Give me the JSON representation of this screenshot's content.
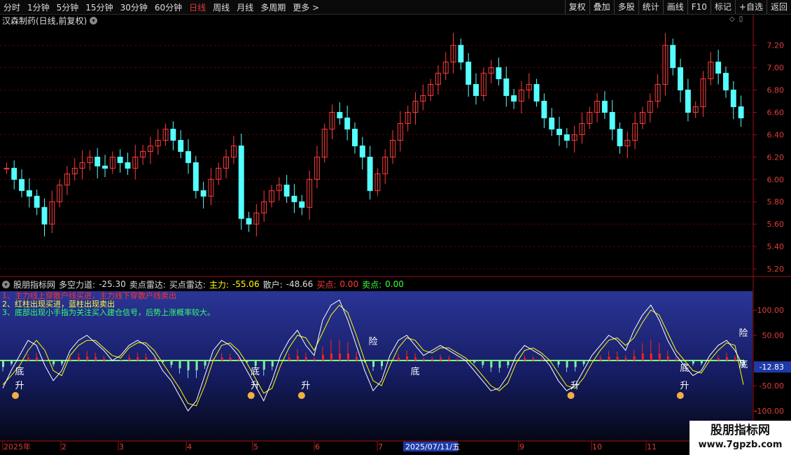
{
  "toolbar": {
    "periods": [
      "分时",
      "1分钟",
      "5分钟",
      "15分钟",
      "30分钟",
      "60分钟",
      "日线",
      "周线",
      "月线",
      "多周期",
      "更多 >"
    ],
    "active_period": "日线",
    "buttons": [
      "复权",
      "叠加",
      "多股",
      "统计",
      "画线",
      "F10",
      "标记",
      "+自选",
      "返回"
    ]
  },
  "stock": {
    "title": "汉森制药(日线,前复权)"
  },
  "price_axis": {
    "ticks": [
      "7.20",
      "7.00",
      "6.80",
      "6.60",
      "6.40",
      "6.20",
      "6.00",
      "5.80",
      "5.60",
      "5.40",
      "5.20"
    ]
  },
  "indicator": {
    "name": "股朋指标网",
    "dkld_label": "多空力道:",
    "dkld_value": "-25.30",
    "mdld_label": "卖点雷达:",
    "mdld2_label": "买点雷达:",
    "zl_label": "主力:",
    "zl_value": "-55.06",
    "sh_label": "散户:",
    "sh_value": "-48.66",
    "sell_label": "买点:",
    "sell_value": "0.00",
    "buy_label": "卖点:",
    "buy_value": "0.00",
    "axis_ticks": [
      "100.00",
      "50.00",
      "-50.00",
      "-100.00"
    ],
    "current_value": "-12.83",
    "legend": [
      "1、主力线上穿散户线买进，主力线下穿散户线卖出",
      "2、红柱出现买进，蓝柱出现卖出",
      "3、底部出现小手指为关注买入建仓信号，后势上涨概率较大。"
    ],
    "marks": {
      "di": "底",
      "sheng": "升",
      "xian": "险"
    }
  },
  "date_axis": {
    "labels": [
      "2025年",
      "2",
      "3",
      "4",
      "5",
      "6",
      "7",
      "2025/07/11/五",
      "9",
      "10",
      "11"
    ]
  },
  "watermark": {
    "title": "股朋指标网",
    "url": "www.7gpzb.com"
  },
  "colors": {
    "up": "#ff3c3c",
    "down": "#54ffff",
    "main_line": "#ffffff",
    "retail_line": "#ffff00",
    "green_band": "#7fff7f",
    "red_band": "#ff2020",
    "indicator_bg": "#1e2a8a"
  },
  "chart_data": {
    "type": "candlestick",
    "price_ylim": [
      5.15,
      7.38
    ],
    "closes": [
      6.1,
      6.0,
      5.9,
      5.85,
      5.75,
      5.6,
      5.8,
      5.95,
      6.05,
      6.1,
      6.15,
      6.2,
      6.12,
      6.1,
      6.2,
      6.15,
      6.1,
      6.2,
      6.25,
      6.3,
      6.35,
      6.45,
      6.35,
      6.25,
      6.15,
      5.9,
      5.85,
      6.0,
      6.1,
      6.2,
      6.3,
      5.65,
      5.6,
      5.7,
      5.8,
      5.9,
      5.95,
      5.85,
      5.8,
      5.75,
      6.0,
      6.2,
      6.45,
      6.6,
      6.55,
      6.45,
      6.3,
      6.2,
      5.9,
      6.05,
      6.2,
      6.35,
      6.5,
      6.6,
      6.7,
      6.75,
      6.85,
      6.95,
      7.05,
      7.2,
      7.05,
      6.85,
      6.75,
      6.95,
      7.0,
      6.9,
      6.75,
      6.7,
      6.8,
      6.85,
      6.7,
      6.55,
      6.45,
      6.4,
      6.35,
      6.4,
      6.5,
      6.6,
      6.7,
      6.6,
      6.45,
      6.3,
      6.35,
      6.5,
      6.6,
      6.7,
      6.85,
      7.2,
      7.0,
      6.8,
      6.6,
      6.65,
      6.9,
      7.05,
      6.95,
      6.8,
      6.65,
      6.55
    ],
    "zhuli": [
      -55,
      -20,
      10,
      40,
      30,
      -10,
      -40,
      -20,
      20,
      40,
      50,
      35,
      20,
      0,
      10,
      30,
      40,
      30,
      10,
      -20,
      -40,
      -70,
      -100,
      -80,
      -30,
      20,
      40,
      30,
      10,
      -20,
      -50,
      -80,
      -40,
      10,
      40,
      60,
      30,
      10,
      80,
      110,
      120,
      80,
      30,
      -20,
      -60,
      -40,
      10,
      40,
      50,
      30,
      10,
      20,
      30,
      20,
      10,
      0,
      -20,
      -40,
      -60,
      -55,
      -30,
      10,
      30,
      20,
      10,
      -10,
      -40,
      -60,
      -50,
      -20,
      10,
      30,
      50,
      40,
      20,
      60,
      90,
      110,
      80,
      40,
      10,
      -10,
      -30,
      -20,
      10,
      30,
      40,
      20,
      -12
    ],
    "sanhu": [
      -48,
      -30,
      -10,
      20,
      40,
      20,
      -20,
      -30,
      10,
      30,
      40,
      40,
      25,
      10,
      5,
      25,
      35,
      35,
      20,
      -5,
      -30,
      -55,
      -85,
      -90,
      -50,
      0,
      30,
      35,
      20,
      -5,
      -35,
      -65,
      -55,
      -10,
      25,
      50,
      45,
      20,
      55,
      90,
      110,
      95,
      50,
      0,
      -40,
      -50,
      -10,
      25,
      45,
      40,
      20,
      15,
      25,
      25,
      15,
      5,
      -10,
      -30,
      -50,
      -60,
      -45,
      -5,
      20,
      25,
      15,
      0,
      -25,
      -50,
      -55,
      -35,
      -5,
      20,
      40,
      45,
      30,
      45,
      75,
      100,
      90,
      55,
      20,
      0,
      -20,
      -25,
      0,
      20,
      35,
      30,
      -48
    ]
  }
}
